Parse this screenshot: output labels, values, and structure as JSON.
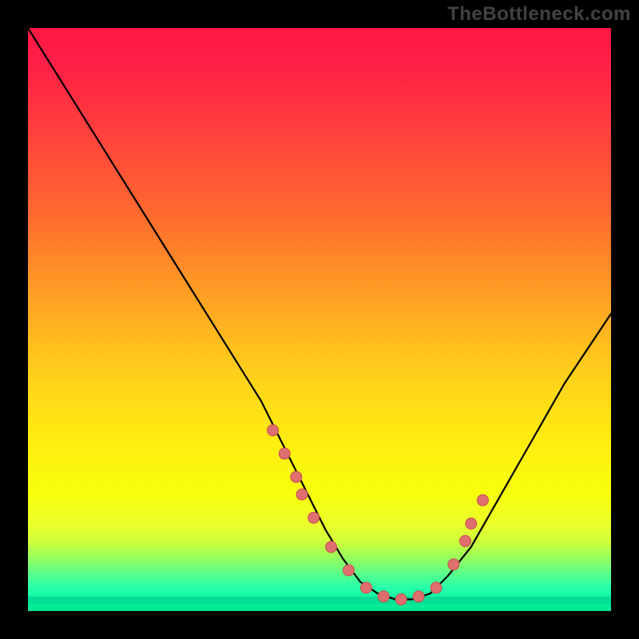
{
  "watermark": "TheBottleneck.com",
  "colors": {
    "page_bg": "#000000",
    "watermark": "#424242",
    "curve": "#000000",
    "dot_fill": "#df6e6e",
    "dot_stroke": "#c94f4f"
  },
  "chart_data": {
    "type": "line",
    "title": "",
    "xlabel": "",
    "ylabel": "",
    "xlim": [
      0,
      100
    ],
    "ylim": [
      0,
      100
    ],
    "grid": false,
    "legend": false,
    "series": [
      {
        "name": "bottleneck-curve",
        "x": [
          0,
          5,
          10,
          15,
          20,
          25,
          30,
          35,
          40,
          44,
          48,
          51,
          54,
          57,
          60,
          63,
          66,
          69,
          72,
          76,
          80,
          84,
          88,
          92,
          96,
          100
        ],
        "y": [
          100,
          92,
          84,
          76,
          68,
          60,
          52,
          44,
          36,
          28,
          20,
          14,
          9,
          5,
          3,
          2,
          2,
          3,
          6,
          11,
          18,
          25,
          32,
          39,
          45,
          51
        ]
      }
    ],
    "markers": {
      "name": "highlight-dots",
      "x": [
        42,
        44,
        46,
        47,
        49,
        52,
        55,
        58,
        61,
        64,
        67,
        70,
        73,
        75,
        76,
        78
      ],
      "y": [
        31,
        27,
        23,
        20,
        16,
        11,
        7,
        4,
        2.5,
        2,
        2.5,
        4,
        8,
        12,
        15,
        19
      ]
    }
  }
}
